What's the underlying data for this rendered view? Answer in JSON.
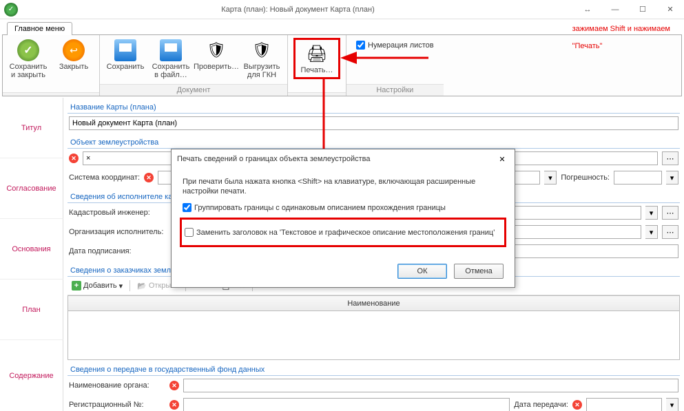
{
  "window": {
    "title": "Карта (план): Новый документ Карта (план)"
  },
  "ribbon": {
    "tab": "Главное меню",
    "groups": {
      "g1_label": "",
      "g2_label": "Документ",
      "g3_label": "",
      "g4_label": "Настройки"
    },
    "buttons": {
      "save_close": "Сохранить и закрыть",
      "close": "Закрыть",
      "save": "Сохранить",
      "save_to_file": "Сохранить в файл…",
      "check": "Проверить…",
      "export_gkn": "Выгрузить для ГКН",
      "print": "Печать…"
    },
    "numbering_checkbox": "Нумерация листов",
    "numbering_checked": true
  },
  "annotation": {
    "line1": "зажимаем Shift и нажимаем",
    "line2": "\"Печать\""
  },
  "sidebar": {
    "items": [
      "Титул",
      "Согласование",
      "Основания",
      "План",
      "Содержание"
    ]
  },
  "form": {
    "sec_name": "Название Карты (плана)",
    "name_value": "Новый документ Карта (план)",
    "sec_object": "Объект землеустройства",
    "object_value": "×",
    "coord_system_label": "Система координат:",
    "accuracy_label": "Погрешность:",
    "sec_executor": "Сведения об исполнителе кадастровых работ",
    "engineer_label": "Кадастровый инженер:",
    "org_label": "Организация исполнитель:",
    "sign_date_label": "Дата подписания:",
    "sec_customers": "Сведения о заказчиках землеустроительных работ",
    "add_btn": "Добавить",
    "open_btn": "Открыть",
    "table_header": "Наименование",
    "sec_transfer": "Сведения о передаче в государственный фонд данных",
    "authority_label": "Наименование органа:",
    "reg_no_label": "Регистрационный №:",
    "transfer_date_label": "Дата передачи:"
  },
  "dialog": {
    "title": "Печать сведений о границах объекта землеустройства",
    "info": "При печати была нажата кнопка <Shift> на клавиатуре, включающая расширенные настройки печати.",
    "opt1": "Группировать границы с одинаковым описанием прохождения границы",
    "opt1_checked": true,
    "opt2": "Заменить заголовок на 'Текстовое и графическое описание местоположения границ'",
    "opt2_checked": false,
    "ok": "ОК",
    "cancel": "Отмена"
  }
}
